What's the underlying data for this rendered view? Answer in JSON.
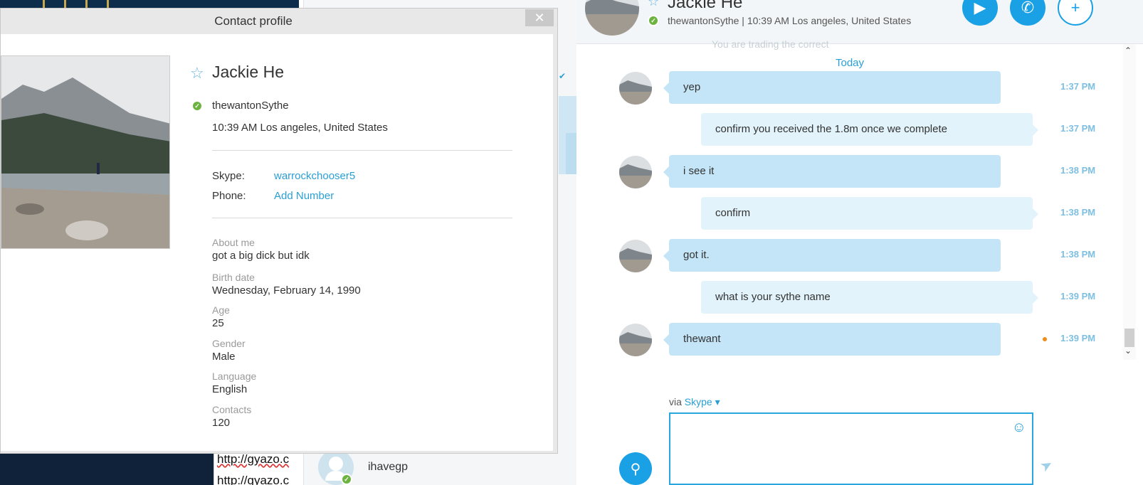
{
  "dialog": {
    "title": "Contact profile",
    "close_glyph": "✕",
    "name": "Jackie He",
    "handle": "thewantonSythe",
    "location": "10:39 AM Los angeles, United States",
    "skype_label": "Skype:",
    "skype_value": "warrockchooser5",
    "phone_label": "Phone:",
    "phone_value": "Add Number",
    "fields": [
      {
        "label": "About me",
        "value": "got a big dick but idk"
      },
      {
        "label": "Birth date",
        "value": "Wednesday, February 14, 1990"
      },
      {
        "label": "Age",
        "value": "25"
      },
      {
        "label": "Gender",
        "value": "Male"
      },
      {
        "label": "Language",
        "value": "English"
      },
      {
        "label": "Contacts",
        "value": "120"
      }
    ]
  },
  "middle": {
    "contact_name": "ihavegp"
  },
  "background_doc": {
    "line1": "http://gyazo.c",
    "line2": "http://gyazo.c"
  },
  "chat": {
    "name": "Jackie He",
    "subtitle": "thewantonSythe  |  10:39 AM Los angeles, United States",
    "faded_text": "You are trading the correct",
    "date_divider": "Today",
    "messages": [
      {
        "dir": "in",
        "text": "yep",
        "time": "1:37 PM"
      },
      {
        "dir": "out",
        "text": "confirm you received the 1.8m once we complete",
        "time": "1:37 PM"
      },
      {
        "dir": "in",
        "text": "i see it",
        "time": "1:38 PM"
      },
      {
        "dir": "out",
        "text": "confirm",
        "time": "1:38 PM"
      },
      {
        "dir": "in",
        "text": "got it.",
        "time": "1:38 PM"
      },
      {
        "dir": "out",
        "text": "what is your sythe name",
        "time": "1:39 PM"
      },
      {
        "dir": "in",
        "text": "thewant",
        "time": "1:39 PM"
      }
    ],
    "via_prefix": "via",
    "via_service": "Skype",
    "icons": {
      "video": "video-icon",
      "call": "phone-icon",
      "add": "add-person-icon",
      "attach": "paperclip-icon",
      "smiley": "smiley-icon",
      "send": "send-icon"
    }
  },
  "colors": {
    "accent": "#1aa0e4",
    "bubble_in": "#c3e5f7",
    "bubble_out": "#e2f3fb",
    "status_online": "#6db33f",
    "unread": "#f08c1a"
  }
}
